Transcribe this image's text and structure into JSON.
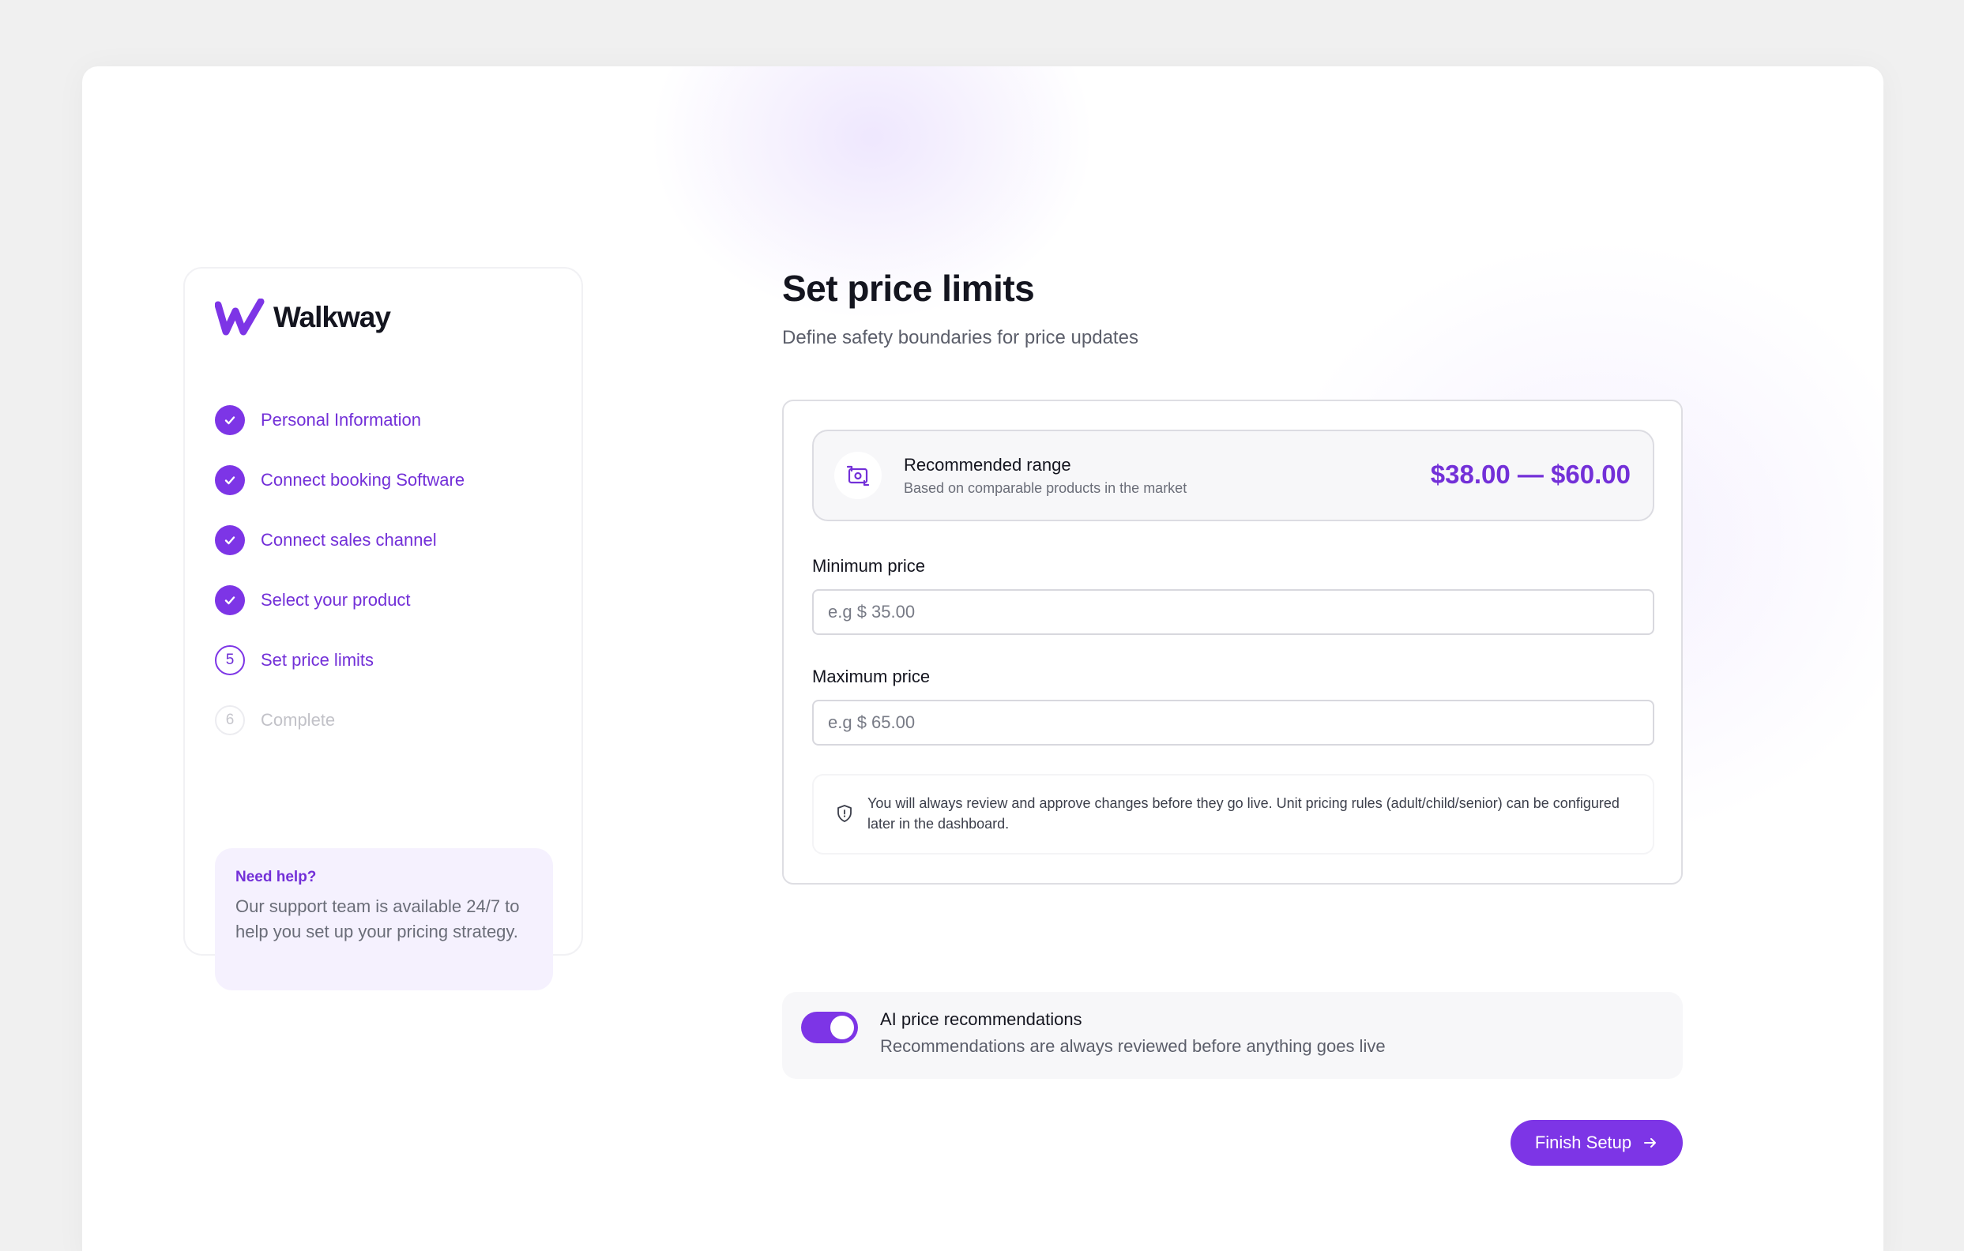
{
  "brand": {
    "name": "Walkway",
    "accent": "#7d35e6"
  },
  "steps": [
    {
      "label": "Personal Information",
      "state": "done"
    },
    {
      "label": "Connect booking Software",
      "state": "done"
    },
    {
      "label": "Connect sales channel",
      "state": "done"
    },
    {
      "label": "Select your product",
      "state": "done"
    },
    {
      "number": "5",
      "label": "Set price limits",
      "state": "current"
    },
    {
      "number": "6",
      "label": "Complete",
      "state": "upcoming"
    }
  ],
  "help": {
    "title": "Need help?",
    "text": "Our support team is available 24/7 to help you set up your pricing strategy."
  },
  "page": {
    "title": "Set price limits",
    "subtitle": "Define safety boundaries for price updates"
  },
  "range": {
    "icon": "price-exchange-icon",
    "title": "Recommended range",
    "subtitle": "Based on comparable products in the market",
    "value": "$38.00 — $60.00"
  },
  "min_price": {
    "label": "Minimum price",
    "placeholder": "e.g $ 35.00",
    "value": ""
  },
  "max_price": {
    "label": "Maximum price",
    "placeholder": "e.g $ 65.00",
    "value": ""
  },
  "note": {
    "icon": "shield-icon",
    "text": "You will always review and approve changes before they go live. Unit pricing rules (adult/child/senior) can be configured later in the dashboard."
  },
  "ai": {
    "title": "AI price recommendations",
    "subtitle": "Recommendations are always reviewed before anything goes live",
    "enabled": true
  },
  "finish_button": {
    "label": "Finish Setup",
    "icon": "arrow-right-icon"
  }
}
